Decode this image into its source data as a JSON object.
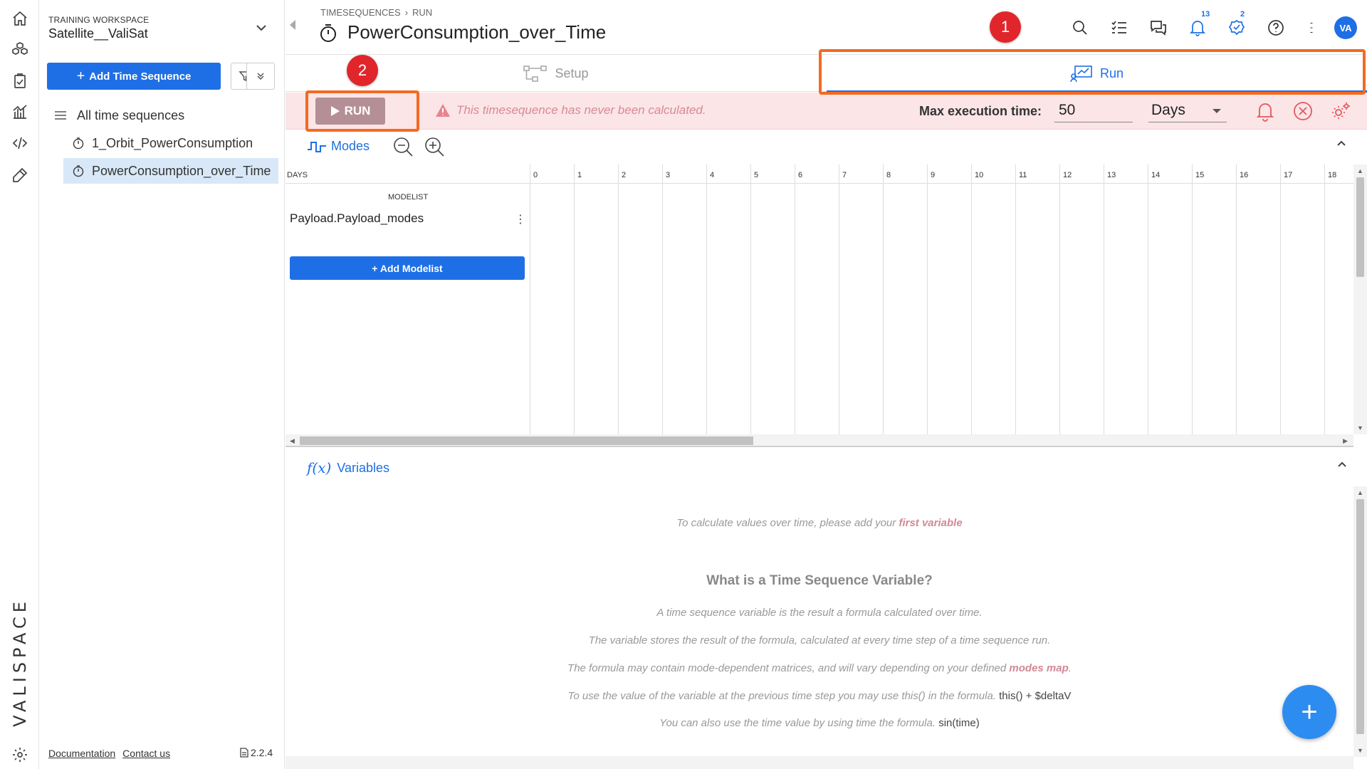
{
  "workspace": {
    "label": "TRAINING WORKSPACE",
    "name": "Satellite__ValiSat"
  },
  "sidebar": {
    "add_button": "Add Time Sequence",
    "all_label": "All time sequences",
    "items": [
      {
        "label": "1_Orbit_PowerConsumption",
        "selected": false
      },
      {
        "label": "PowerConsumption_over_Time",
        "selected": true
      }
    ],
    "footer": {
      "documentation": "Documentation",
      "contact": "Contact us",
      "version": "2.2.4"
    }
  },
  "brand": "VALISPACE",
  "header": {
    "breadcrumb": [
      "TIMESEQUENCES",
      "RUN"
    ],
    "title": "PowerConsumption_over_Time",
    "notifications_count": "13",
    "tasks_count": "2",
    "avatar": "VA"
  },
  "annotations": {
    "badge1": "1",
    "badge2": "2",
    "highlight_color": "#f26a22",
    "badge_color": "#e0262b"
  },
  "tabs": {
    "setup": "Setup",
    "run": "Run"
  },
  "runbar": {
    "run_label": "RUN",
    "warning": "This timesequence has never been calculated.",
    "max_label": "Max execution time:",
    "max_value": "50",
    "unit": "Days"
  },
  "modes": {
    "title": "Modes",
    "days_label": "DAYS",
    "modelist_label": "MODELIST",
    "modelist_name": "Payload.Payload_modes",
    "add_modelist": "+ Add Modelist",
    "day_ticks": [
      "0",
      "1",
      "2",
      "3",
      "4",
      "5",
      "6",
      "7",
      "8",
      "9",
      "10",
      "11",
      "12",
      "13",
      "14",
      "15",
      "16",
      "17",
      "18"
    ]
  },
  "variables": {
    "title": "Variables",
    "fx": "f(x)",
    "empty_text": "To calculate values over time, please add your",
    "empty_link": "first variable",
    "what_title": "What is a Time Sequence Variable?",
    "line1": "A time sequence variable is the result a formula calculated over time.",
    "line2": "The variable stores the result of the formula, calculated at every time step of a time sequence run.",
    "line3_a": "The formula may contain mode-dependent matrices, and will vary depending on your defined",
    "line3_link": "modes map",
    "line4_a": "To use the value of the variable at the previous time step you may use this() in the formula.",
    "line4_code": "this() + $deltaV",
    "line5_a": "You can also use the time value by using time the formula.",
    "line5_code": "sin(time)"
  },
  "colors": {
    "accent": "#1e6fe5",
    "runbar_bg": "#fbe5e7",
    "warning_text": "#d88a94"
  }
}
